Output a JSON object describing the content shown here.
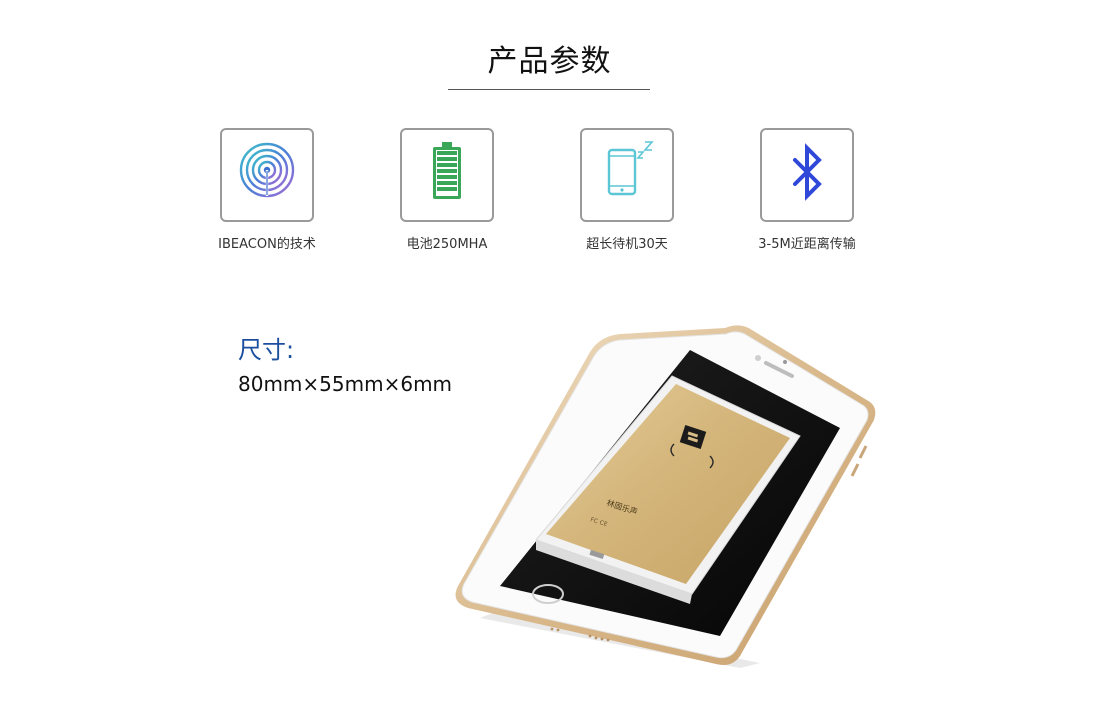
{
  "section": {
    "title": "产品参数"
  },
  "features": [
    {
      "label": "IBEACON的技术",
      "icon": "ibeacon-icon"
    },
    {
      "label": "电池250MHA",
      "icon": "battery-icon"
    },
    {
      "label": "超长待机30天",
      "icon": "sleep-phone-icon"
    },
    {
      "label": "3-5M近距离传输",
      "icon": "bluetooth-icon"
    }
  ],
  "size": {
    "heading": "尺寸:",
    "value": "80mm×55mm×6mm"
  },
  "product": {
    "logo_text": "林固乐声"
  },
  "colors": {
    "title_line": "#555555",
    "box_border": "#9a9a9a",
    "size_heading": "#1b4f9e",
    "battery_green": "#3aa657",
    "phone_teal": "#5cc6d6",
    "bluetooth_blue": "#2f48d8",
    "device_gold": "#d9c08a",
    "phone_frame": "#e2c9a6"
  }
}
